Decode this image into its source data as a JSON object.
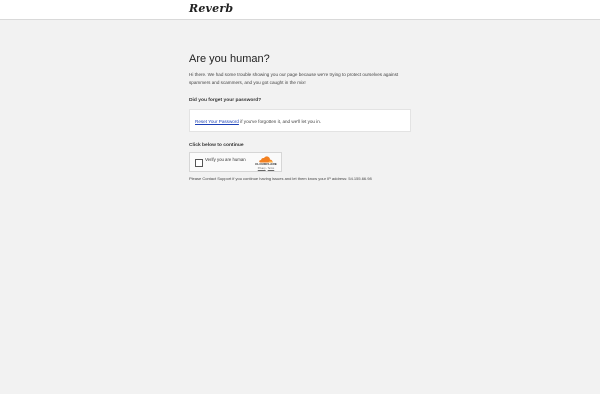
{
  "header": {
    "logo_text": "Reverb"
  },
  "main": {
    "title": "Are you human?",
    "intro": "Hi there. We had some trouble showing you our page because we're trying to protect ourselves against spammers and scammers, and you got caught in the mix!",
    "forgot_heading": "Did you forget your password?",
    "reset_link": "Reset Your Password",
    "reset_rest": " if you've forgotten it, and we'll let you in.",
    "continue_heading": "Click below to continue",
    "captcha": {
      "label": "Verify you are human",
      "brand": "CLOUDFLARE",
      "privacy": "Privacy",
      "separator": " - ",
      "terms": "Terms"
    },
    "footer_note": "Please Contact Support if you continue having issues and let them know your IP address: 54.155.66.98"
  },
  "colors": {
    "link": "#1a3fb5",
    "cloudflare_orange": "#f38020",
    "background": "#f2f2f2"
  }
}
